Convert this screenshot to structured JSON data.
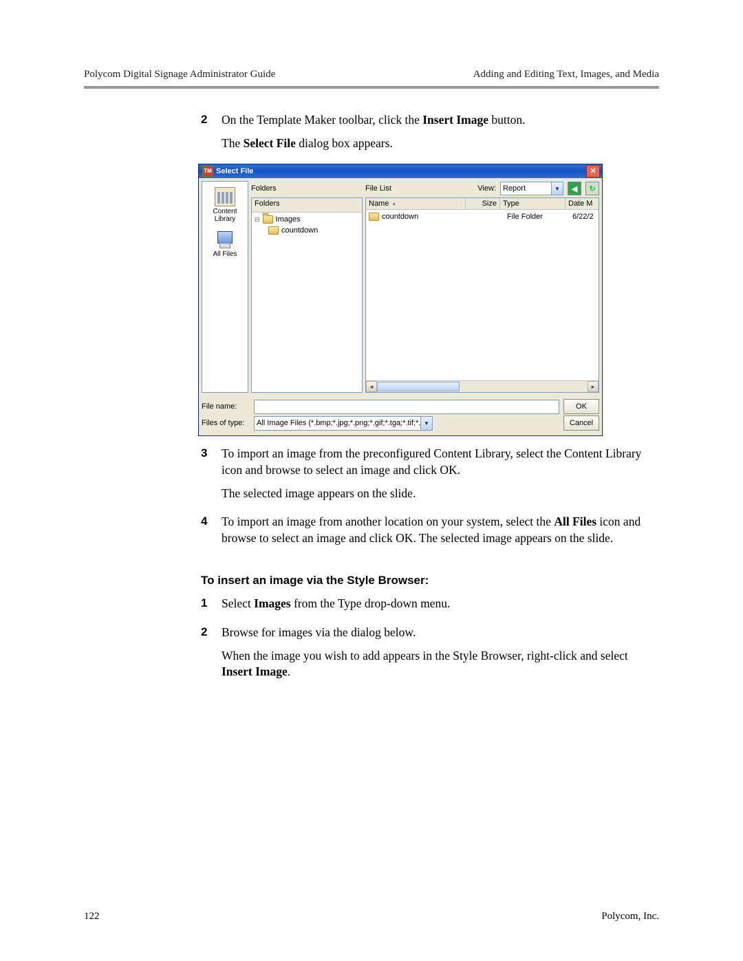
{
  "header": {
    "left": "Polycom Digital Signage Administrator Guide",
    "right": "Adding and Editing Text, Images, and Media"
  },
  "steps_first": [
    {
      "num": "2",
      "paras": [
        {
          "plain1": "On the Template Maker toolbar, click the ",
          "bold1": "Insert Image",
          "plain2": " button."
        },
        {
          "plain1": "The ",
          "bold1": "Select File",
          "plain2": " dialog box appears."
        }
      ]
    }
  ],
  "dialog": {
    "title": "Select File",
    "close_tooltip": "Close",
    "leftbar": [
      {
        "key": "content-library",
        "label": "Content\nLibrary",
        "icon": "lib"
      },
      {
        "key": "all-files",
        "label": "All Files",
        "icon": "pc"
      }
    ],
    "folders_label": "Folders",
    "filelist_label": "File List",
    "view_label": "View:",
    "view_value": "Report",
    "tree": [
      {
        "name": "Images",
        "level": 0,
        "open": true
      },
      {
        "name": "countdown",
        "level": 1,
        "open": false
      }
    ],
    "columns": {
      "name": "Name",
      "size": "Size",
      "type": "Type",
      "date": "Date M"
    },
    "rows": [
      {
        "name": "countdown",
        "size": "",
        "type": "File Folder",
        "date": "6/22/2"
      }
    ],
    "filename_label": "File name:",
    "filename_value": "",
    "filetype_label": "Files of type:",
    "filetype_value": "All Image Files (*.bmp;*.jpg;*.png;*.gif;*.tga;*.tif;*.tiff;*.psd;*.vpb;*.p",
    "ok": "OK",
    "cancel": "Cancel"
  },
  "steps_second": [
    {
      "num": "3",
      "paras": [
        {
          "plain1": "To import an image from the preconfigured Content Library, select the Content Library icon and browse to select an image and click OK."
        },
        {
          "plain1": "The selected image appears on the slide."
        }
      ]
    },
    {
      "num": "4",
      "paras": [
        {
          "plain1": "To import an image from another location on your system, select the ",
          "bold1": "All Files",
          "plain2": " icon and browse to select an image and click OK. The selected image appears on the slide."
        }
      ]
    }
  ],
  "section_heading": "To insert an image via the Style Browser:",
  "steps_third": [
    {
      "num": "1",
      "paras": [
        {
          "plain1": "Select ",
          "bold1": "Images",
          "plain2": " from the Type drop-down menu."
        }
      ]
    },
    {
      "num": "2",
      "paras": [
        {
          "plain1": "Browse for images via the dialog below."
        },
        {
          "plain1": "When the image you wish to add appears in the Style Browser, right-click and select ",
          "bold1": "Insert Image",
          "plain2": "."
        }
      ]
    }
  ],
  "footer": {
    "page": "122",
    "company": "Polycom, Inc."
  }
}
